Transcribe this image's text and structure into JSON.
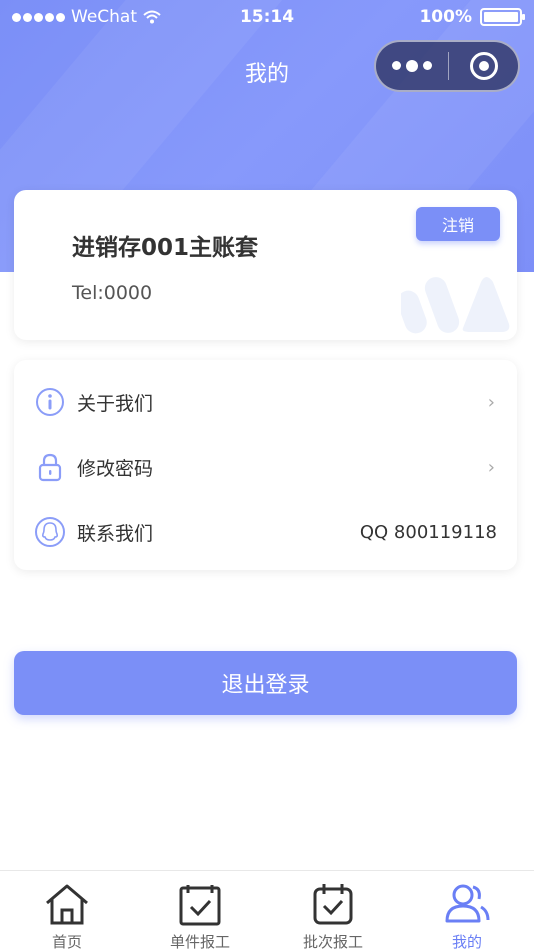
{
  "status_bar": {
    "carrier": "WeChat",
    "time": "15:14",
    "battery": "100%"
  },
  "nav": {
    "title": "我的"
  },
  "user_card": {
    "name": "进销存001主账套",
    "tel": "Tel:0000",
    "logout_label": "注销"
  },
  "menu": {
    "items": [
      {
        "label": "关于我们",
        "icon": "info-icon"
      },
      {
        "label": "修改密码",
        "icon": "lock-icon"
      },
      {
        "label": "联系我们",
        "icon": "qq-icon",
        "value": "QQ 800119118"
      }
    ]
  },
  "exit_button": {
    "label": "退出登录"
  },
  "tabbar": {
    "items": [
      {
        "label": "首页",
        "icon": "home-icon"
      },
      {
        "label": "单件报工",
        "icon": "clipboard-check-icon"
      },
      {
        "label": "批次报工",
        "icon": "calendar-check-icon"
      },
      {
        "label": "我的",
        "icon": "users-icon",
        "active": true
      }
    ]
  },
  "colors": {
    "accent": "#7b8ff7",
    "active_tab": "#6a7ff5"
  }
}
